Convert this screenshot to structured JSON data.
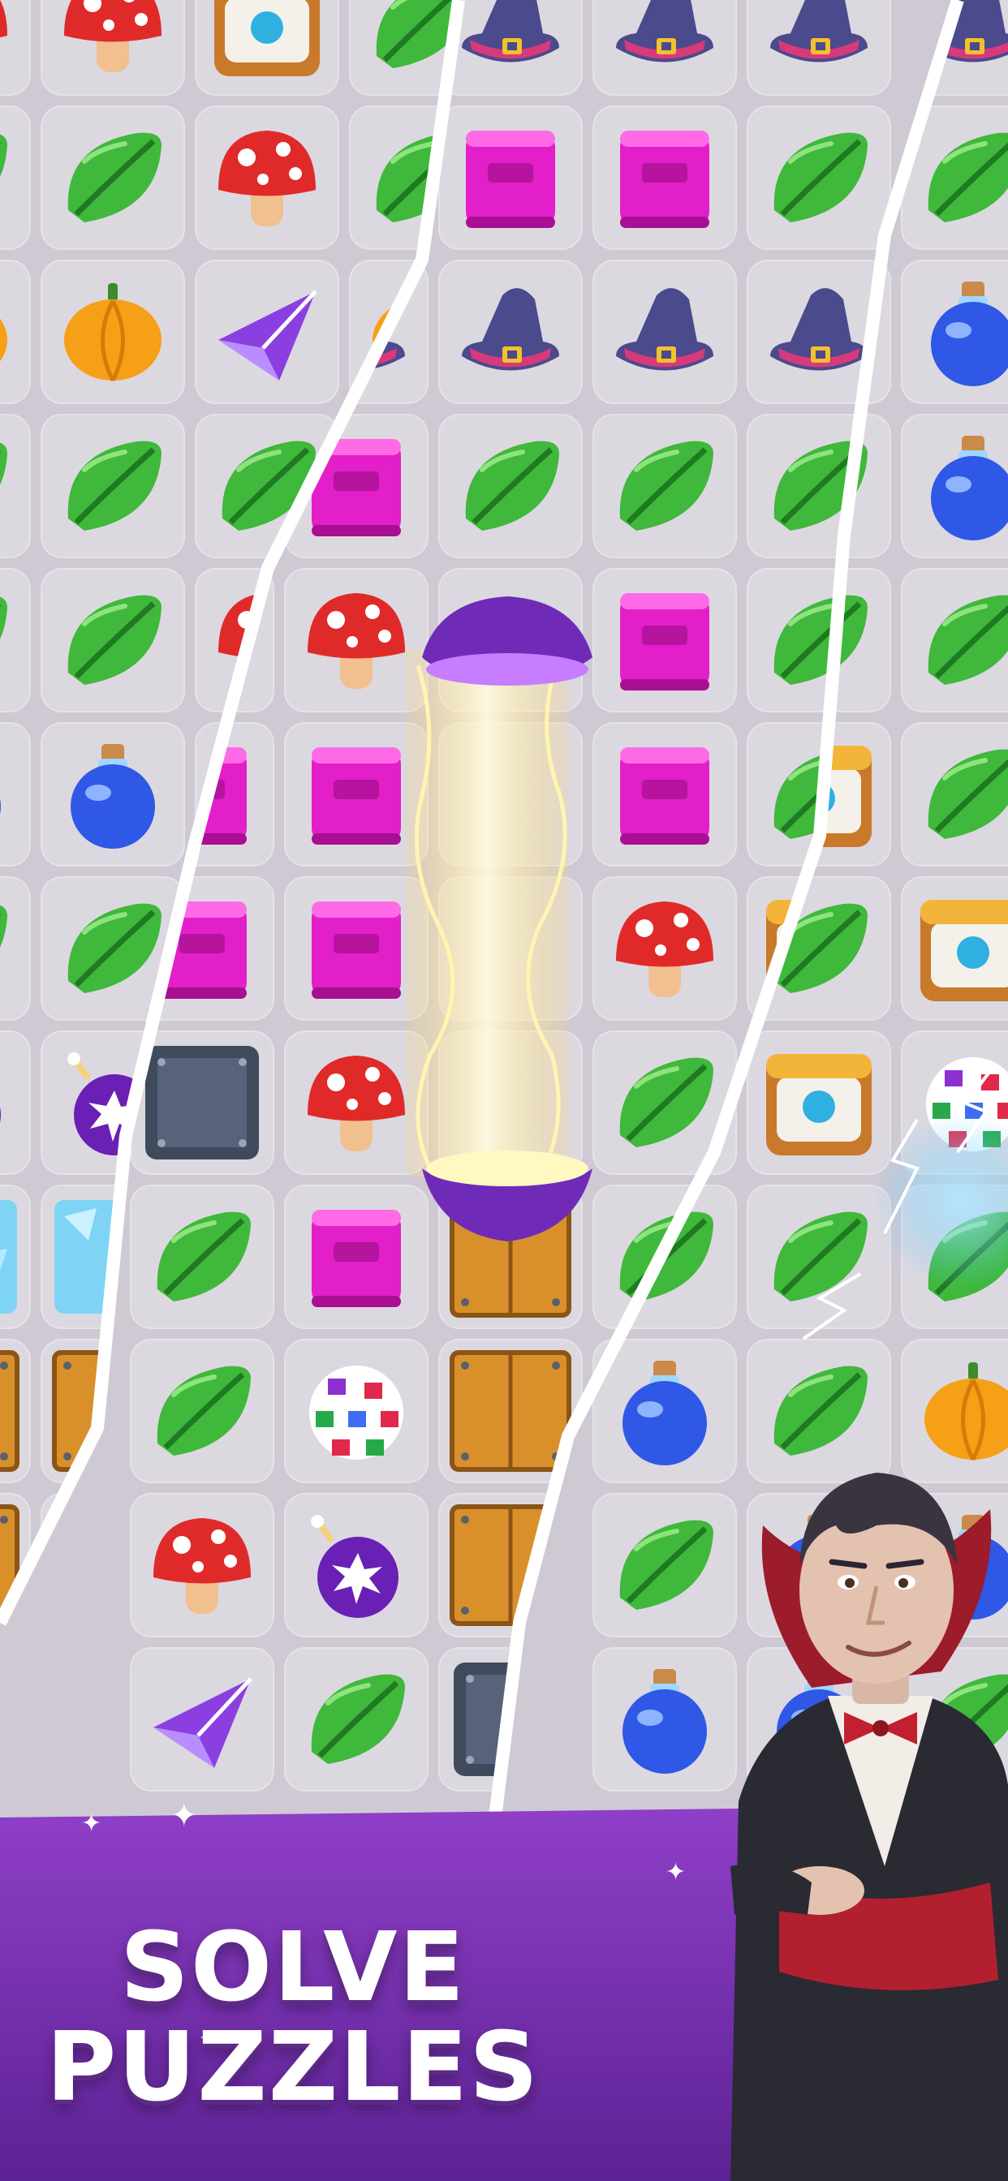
{
  "promo": {
    "title_line1": "SOLVE",
    "title_line2": "PUZZLES"
  },
  "colors": {
    "banner": "#7b2fb0",
    "banner_dark": "#5d2294",
    "tile": "#e4dfe8",
    "board_bg": "#cfc9d4"
  },
  "icons": [
    "leaf-icon",
    "mushroom-icon",
    "book-icon",
    "witch-hat-icon",
    "potion-icon",
    "pumpkin-icon",
    "bomb-icon",
    "paper-plane-icon",
    "disco-ball-icon",
    "wooden-crate-icon",
    "chest-icon",
    "rocket-beam-icon"
  ]
}
